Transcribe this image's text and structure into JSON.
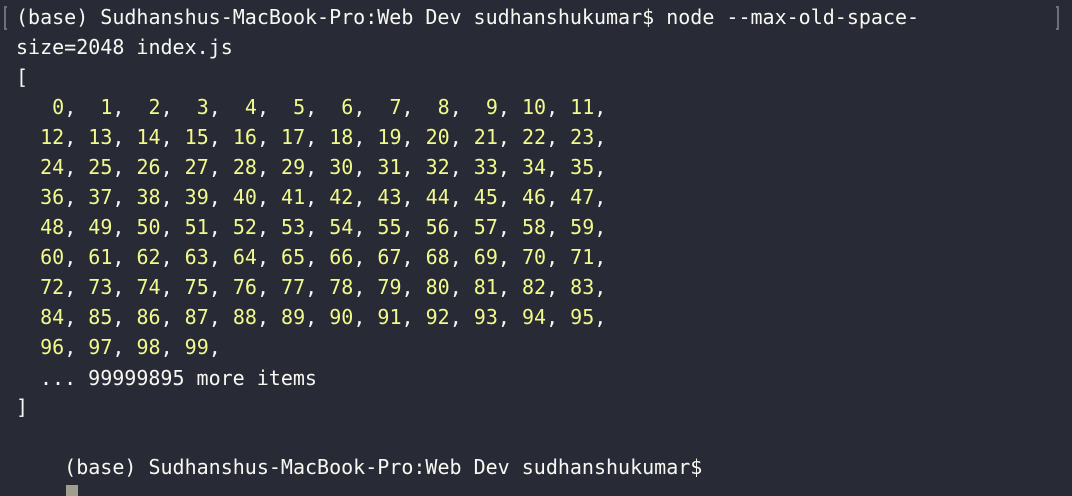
{
  "terminal": {
    "command_line_1": "(base) Sudhanshus-MacBook-Pro:Web Dev sudhanshukumar$ node --max-old-space-",
    "command_line_2": "size=2048 index.js",
    "array_open": "[",
    "array_rows": [
      [
        "0",
        "1",
        "2",
        "3",
        "4",
        "5",
        "6",
        "7",
        "8",
        "9",
        "10",
        "11"
      ],
      [
        "12",
        "13",
        "14",
        "15",
        "16",
        "17",
        "18",
        "19",
        "20",
        "21",
        "22",
        "23"
      ],
      [
        "24",
        "25",
        "26",
        "27",
        "28",
        "29",
        "30",
        "31",
        "32",
        "33",
        "34",
        "35"
      ],
      [
        "36",
        "37",
        "38",
        "39",
        "40",
        "41",
        "42",
        "43",
        "44",
        "45",
        "46",
        "47"
      ],
      [
        "48",
        "49",
        "50",
        "51",
        "52",
        "53",
        "54",
        "55",
        "56",
        "57",
        "58",
        "59"
      ],
      [
        "60",
        "61",
        "62",
        "63",
        "64",
        "65",
        "66",
        "67",
        "68",
        "69",
        "70",
        "71"
      ],
      [
        "72",
        "73",
        "74",
        "75",
        "76",
        "77",
        "78",
        "79",
        "80",
        "81",
        "82",
        "83"
      ],
      [
        "84",
        "85",
        "86",
        "87",
        "88",
        "89",
        "90",
        "91",
        "92",
        "93",
        "94",
        "95"
      ],
      [
        "96",
        "97",
        "98",
        "99"
      ]
    ],
    "more_items": "... 99999895 more items",
    "array_close": "]",
    "prompt": "(base) Sudhanshus-MacBook-Pro:Web Dev sudhanshukumar$",
    "colors": {
      "background": "#282a36",
      "foreground": "#f8f8f2",
      "number": "#f1fa8c",
      "cursor": "#a19e8e"
    }
  }
}
